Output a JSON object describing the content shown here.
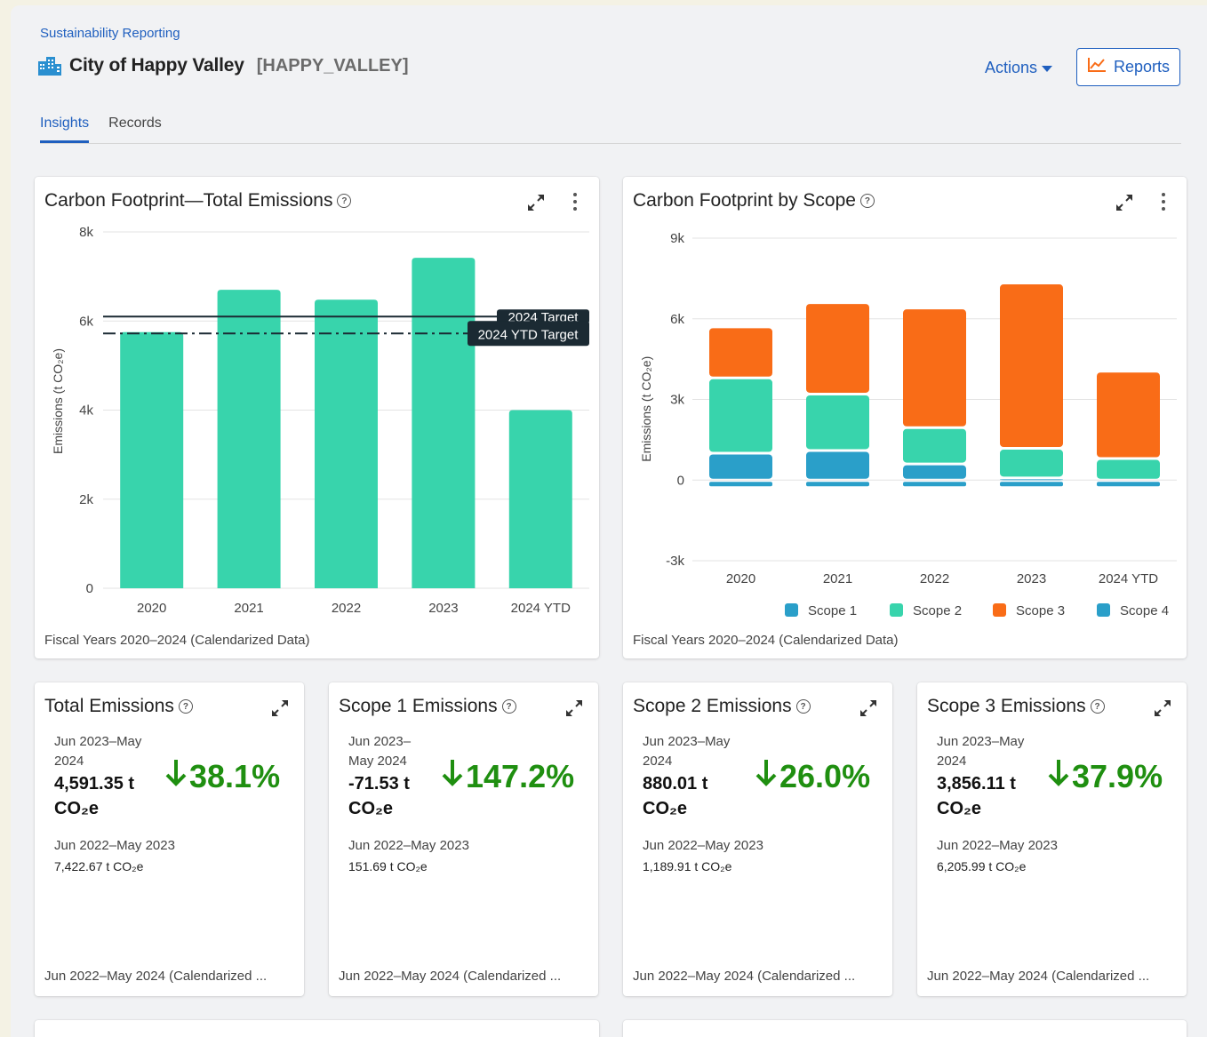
{
  "breadcrumb": "Sustainability Reporting",
  "header": {
    "title": "City of Happy Valley",
    "code": "[HAPPY_VALLEY]",
    "actions_label": "Actions",
    "reports_label": "Reports"
  },
  "tabs": [
    {
      "label": "Insights",
      "active": true
    },
    {
      "label": "Records",
      "active": false
    }
  ],
  "colors": {
    "accent": "#1f5fbf",
    "bar": "#38d4ac",
    "scope1": "#2a9fc9",
    "scope2": "#38d4ac",
    "scope3": "#f96c17",
    "scope4": "#2a9fc9",
    "positive_change": "#1f8f10"
  },
  "total_chart": {
    "title": "Carbon Footprint—Total Emissions",
    "footer": "Fiscal Years 2020–2024 (Calendarized Data)",
    "target_label": "2024 Target",
    "ytd_target_label": "2024 YTD Target"
  },
  "scope_chart": {
    "title": "Carbon Footprint by Scope",
    "footer": "Fiscal Years 2020–2024 (Calendarized Data)"
  },
  "chart_data": [
    {
      "type": "bar",
      "title": "Carbon Footprint—Total Emissions",
      "ylabel": "Emissions (t CO₂e)",
      "categories": [
        "2020",
        "2021",
        "2022",
        "2023",
        "2024 YTD"
      ],
      "values": [
        5750,
        6700,
        6480,
        7420,
        4000
      ],
      "ylim": [
        0,
        8000
      ],
      "yticks": [
        0,
        2000,
        4000,
        6000,
        8000
      ],
      "ytick_labels": [
        "0",
        "2k",
        "4k",
        "6k",
        "8k"
      ],
      "reference_lines": [
        {
          "name": "2024 Target",
          "value": 6100,
          "style": "solid"
        },
        {
          "name": "2024 YTD Target",
          "value": 5720,
          "style": "dash-dot"
        }
      ],
      "grid": true
    },
    {
      "type": "bar",
      "stacked": true,
      "title": "Carbon Footprint by Scope",
      "ylabel": "Emissions (t CO₂e)",
      "categories": [
        "2020",
        "2021",
        "2022",
        "2023",
        "2024 YTD"
      ],
      "series": [
        {
          "name": "Scope 1",
          "values": [
            1000,
            1100,
            600,
            80,
            0
          ]
        },
        {
          "name": "Scope 2",
          "values": [
            2800,
            2100,
            1350,
            1100,
            800
          ]
        },
        {
          "name": "Scope 3",
          "values": [
            1900,
            3400,
            4450,
            6150,
            3250
          ]
        },
        {
          "name": "Scope 4",
          "values": [
            -200,
            -200,
            -200,
            -200,
            -200
          ]
        }
      ],
      "ylim": [
        -3000,
        9000
      ],
      "yticks": [
        -3000,
        0,
        3000,
        6000,
        9000
      ],
      "ytick_labels": [
        "-3k",
        "0",
        "3k",
        "6k",
        "9k"
      ],
      "legend": "bottom",
      "grid": true
    }
  ],
  "kpis": [
    {
      "title": "Total Emissions",
      "period_a": "Jun 2023–May",
      "period_b": "2024",
      "value_a": "4,591.35 t",
      "value_b": "CO₂e",
      "pct": "38.1%",
      "prev_period": "Jun 2022–May 2023",
      "prev_value": "7,422.67 t CO₂e",
      "footer": "Jun 2022–May 2024 (Calendarized ..."
    },
    {
      "title": "Scope 1 Emissions",
      "period_a": "Jun 2023–",
      "period_b": "May 2024",
      "value_a": "-71.53 t",
      "value_b": "CO₂e",
      "pct": "147.2%",
      "prev_period": "Jun 2022–May 2023",
      "prev_value": "151.69 t CO₂e",
      "footer": "Jun 2022–May 2024 (Calendarized ..."
    },
    {
      "title": "Scope 2 Emissions",
      "period_a": "Jun 2023–May",
      "period_b": "2024",
      "value_a": "880.01 t",
      "value_b": "CO₂e",
      "pct": "26.0%",
      "prev_period": "Jun 2022–May 2023",
      "prev_value": "1,189.91 t CO₂e",
      "footer": "Jun 2022–May 2024 (Calendarized ..."
    },
    {
      "title": "Scope 3 Emissions",
      "period_a": "Jun 2023–May",
      "period_b": "2024",
      "value_a": "3,856.11 t",
      "value_b": "CO₂e",
      "pct": "37.9%",
      "prev_period": "Jun 2022–May 2023",
      "prev_value": "6,205.99 t CO₂e",
      "footer": "Jun 2022–May 2024 (Calendarized ..."
    }
  ],
  "icons": {
    "building": "building-icon",
    "caret": "caret-down-icon",
    "reports": "line-chart-icon",
    "help": "help-icon",
    "expand": "expand-icon",
    "more": "more-vert-icon",
    "arrow": "arrow-down-icon"
  }
}
